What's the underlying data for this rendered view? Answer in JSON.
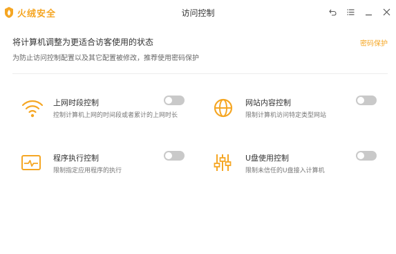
{
  "app": {
    "brand": "火绒安全",
    "window_title": "访问控制",
    "accent_color": "#f5a623",
    "window_controls": [
      "back-icon",
      "menu-icon",
      "minimize-icon",
      "close-icon"
    ]
  },
  "header": {
    "title": "将计算机调整为更适合访客使用的状态",
    "subtitle": "为防止访问控制配置以及其它配置被修改，推荐使用密码保护",
    "password_link": "密码保护"
  },
  "controls": [
    {
      "title": "上网时段控制",
      "desc": "控制计算机上网的时间段或者累计的上网时长",
      "icon": "wifi-icon",
      "enabled": false
    },
    {
      "title": "网站内容控制",
      "desc": "限制计算机访问特定类型网站",
      "icon": "globe-icon",
      "enabled": false
    },
    {
      "title": "程序执行控制",
      "desc": "限制指定应用程序的执行",
      "icon": "program-monitor-icon",
      "enabled": false
    },
    {
      "title": "U盘使用控制",
      "desc": "限制未信任的U盘接入计算机",
      "icon": "usb-sliders-icon",
      "enabled": false
    }
  ]
}
